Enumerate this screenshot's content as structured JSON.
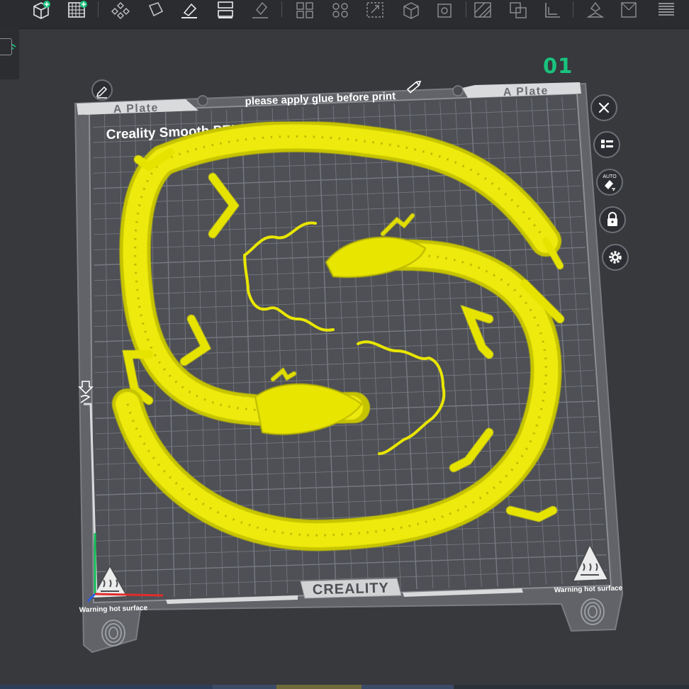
{
  "toolbar": {
    "icons": [
      "add-object-icon",
      "add-plate-icon",
      "arrange-icon",
      "orient-icon",
      "lay-on-face-icon",
      "split-plates-icon",
      "support-paint-icon",
      "cut-icon",
      "boolean-icon",
      "measure-icon",
      "assembly-icon",
      "seam-paint-icon",
      "hollow-icon",
      "emboss-icon",
      "text-icon",
      "scale-icon",
      "shell-icon",
      "color-paint-icon",
      "variable-layer-icon",
      "layers-icon"
    ]
  },
  "plate": {
    "index": "01",
    "name_left": "A Plate",
    "name_right": "A Plate",
    "glue_note": "please apply glue before print",
    "plate_type": "Creality Smooth PEI Plate",
    "brand": "CREALITY",
    "warning_left": "Warning hot surface",
    "warning_right": "Warning hot surface"
  },
  "side_buttons": [
    "close-icon",
    "object-list-icon",
    "auto-orient-icon",
    "lock-icon",
    "settings-icon"
  ],
  "auto_badge": "AUTO",
  "colors": {
    "background": "#37393d",
    "bed": "#5a5c61",
    "grid": "#8e9196",
    "model": "#e9e600",
    "accent": "#19c37d"
  }
}
